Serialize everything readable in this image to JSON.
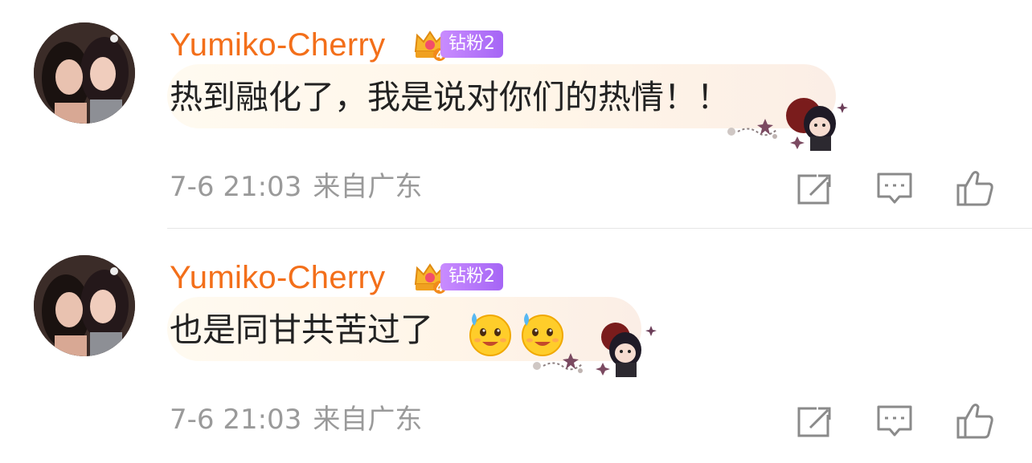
{
  "comments": [
    {
      "username": "Yumiko-Cherry",
      "fan_badge": "钻粉2",
      "crown_level": "4",
      "text": "热到融化了，我是说对你们的热情！！",
      "time": "7-6 21:03",
      "location": "来自广东",
      "emojis": []
    },
    {
      "username": "Yumiko-Cherry",
      "fan_badge": "钻粉2",
      "crown_level": "4",
      "text": "也是同甘共苦过了",
      "time": "7-6 21:03",
      "location": "来自广东",
      "emojis": [
        "sweat-smile-emoji",
        "sweat-smile-emoji"
      ]
    }
  ],
  "colors": {
    "username": "#f36f1a",
    "fan_badge_start": "#c98cff",
    "fan_badge_end": "#a565f5",
    "meta_text": "#9a9a9a",
    "icon": "#8a8a8a",
    "bubble": "#fff5e8"
  },
  "icons": {
    "share": "share-icon",
    "reply": "comment-icon",
    "like": "thumbs-up-icon"
  }
}
